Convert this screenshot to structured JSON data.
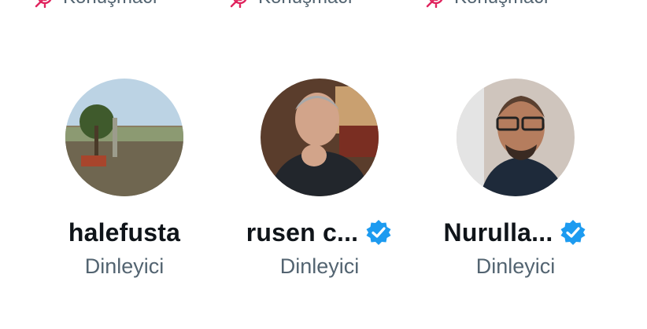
{
  "colors": {
    "accent": "#1d9bf0",
    "mic_off": "#e0245e",
    "text_primary": "#0f1419",
    "text_secondary": "#536471"
  },
  "top_row": [
    {
      "label": "Konuşmacı",
      "icon": "mic-off-icon"
    },
    {
      "label": "Konuşmacı",
      "icon": "mic-off-icon"
    },
    {
      "label": "Konuşmacı",
      "icon": "mic-off-icon"
    }
  ],
  "participants": [
    {
      "name": "halefusta",
      "role": "Dinleyici",
      "verified": false
    },
    {
      "name": "rusen c...",
      "role": "Dinleyici",
      "verified": true,
      "icon": "verified-badge-icon"
    },
    {
      "name": "Nurulla...",
      "role": "Dinleyici",
      "verified": true,
      "icon": "verified-badge-icon"
    }
  ]
}
